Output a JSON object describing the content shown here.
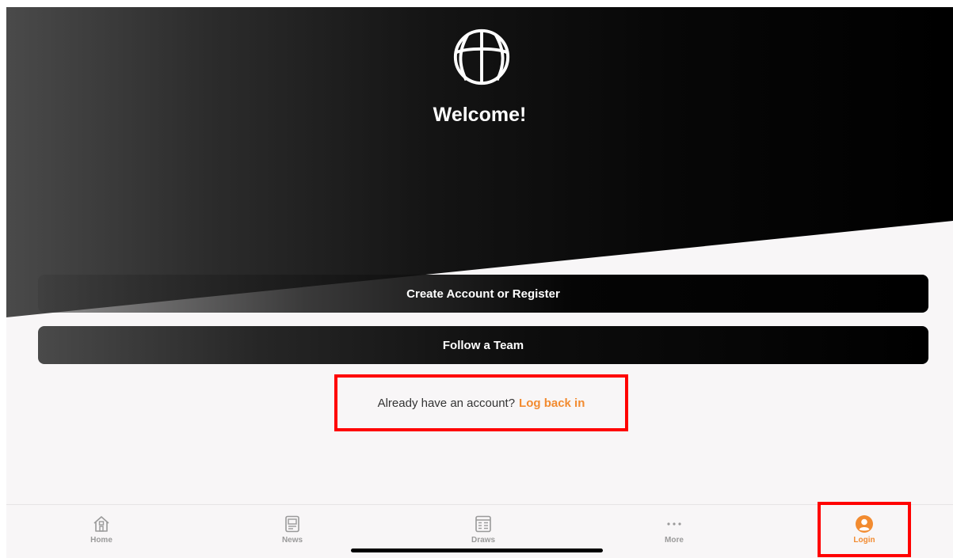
{
  "hero": {
    "logo_icon": "basketball-icon",
    "title": "Welcome!"
  },
  "actions": {
    "create_account_label": "Create Account or Register",
    "follow_team_label": "Follow a Team"
  },
  "login_prompt": {
    "text": "Already have an account?",
    "link_label": "Log back in"
  },
  "tabbar": {
    "items": [
      {
        "label": "Home",
        "icon": "home-icon"
      },
      {
        "label": "News",
        "icon": "news-icon"
      },
      {
        "label": "Draws",
        "icon": "draws-icon"
      },
      {
        "label": "More",
        "icon": "more-icon"
      },
      {
        "label": "Login",
        "icon": "user-icon",
        "active": true
      }
    ]
  },
  "colors": {
    "accent": "#f28b30",
    "inactive_tab": "#9a9a9a",
    "highlight_box": "#ff0000"
  }
}
